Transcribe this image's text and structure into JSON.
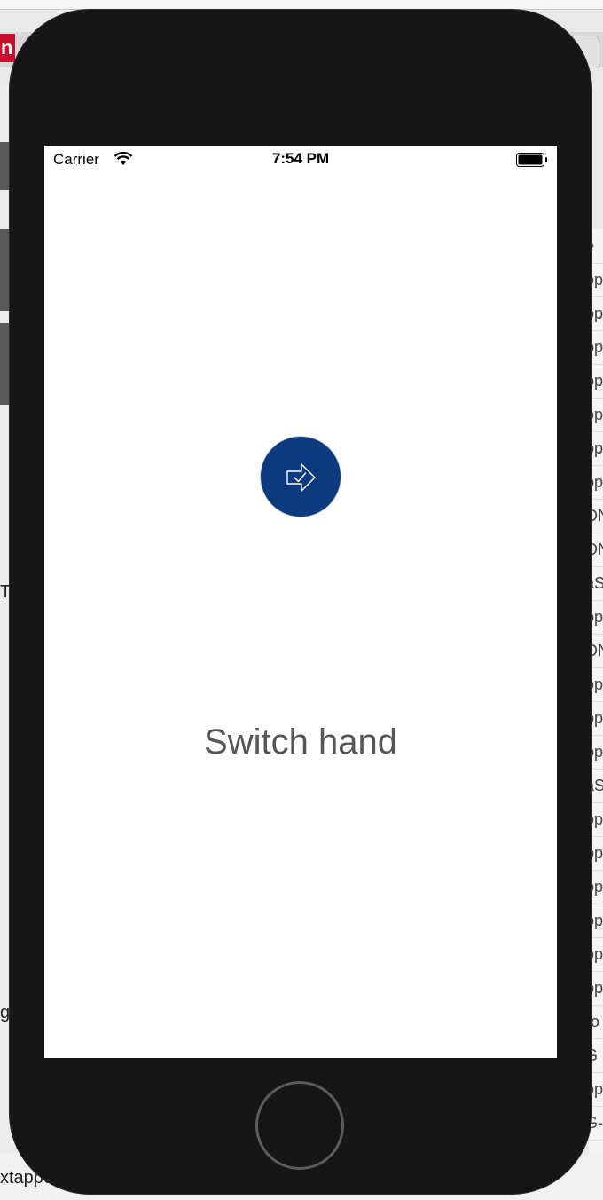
{
  "status_bar": {
    "carrier": "Carrier",
    "time": "7:54 PM"
  },
  "main": {
    "action_icon": "arrow-right-check-icon",
    "message": "Switch hand"
  },
  "colors": {
    "button_fill": "#0d3a7e",
    "message_text": "#555555",
    "device_frame": "#161616"
  },
  "background": {
    "left_labels": [
      "Ta",
      "g."
    ],
    "bottom_text": "xtappe",
    "right_fragments": [
      "e",
      "op",
      "op",
      "op",
      "op",
      "op",
      "op",
      "op",
      "ON",
      "ON",
      "aS",
      "op",
      "ON",
      "op",
      "op",
      "op",
      "aS",
      "op",
      "op",
      "op",
      "op",
      "op",
      "op",
      "ro",
      "G",
      "op",
      "G-"
    ]
  }
}
